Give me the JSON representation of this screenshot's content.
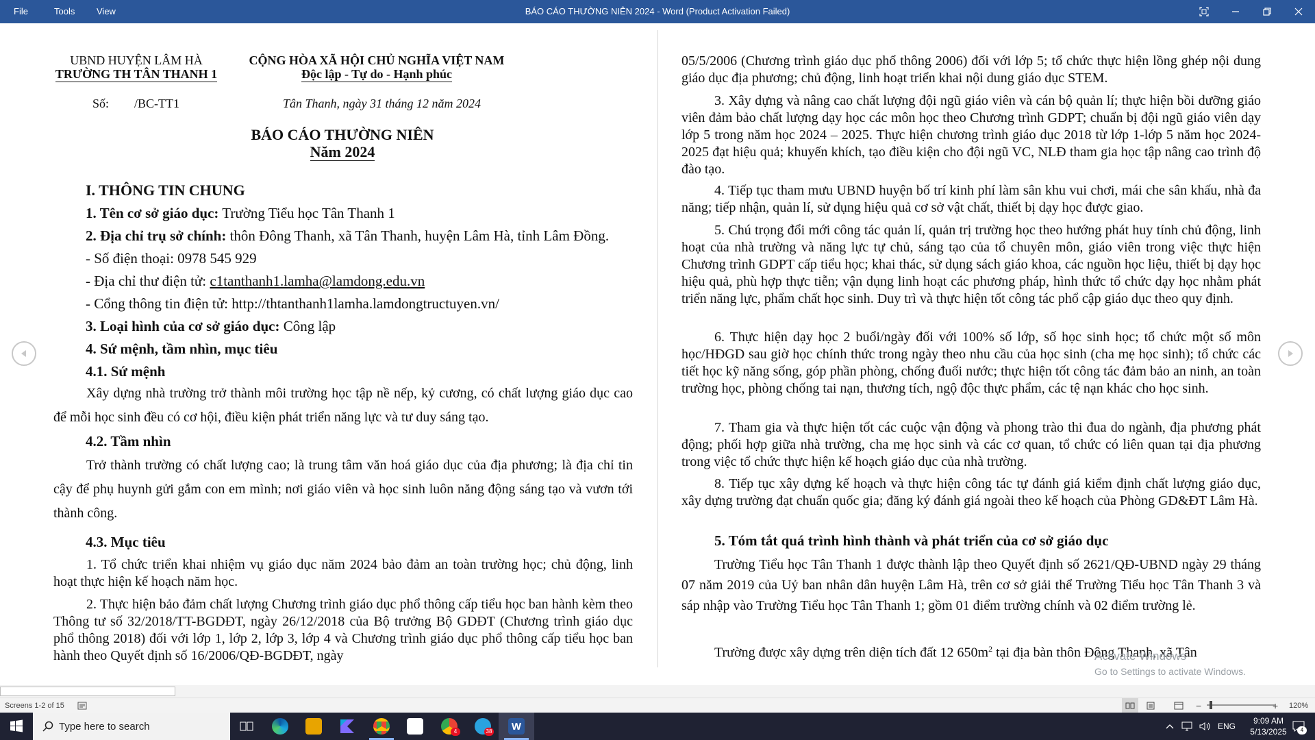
{
  "window": {
    "menu": [
      "File",
      "Tools",
      "View"
    ],
    "title": "BÁO CÁO THƯỜNG NIÊN 2024 - Word (Product Activation Failed)"
  },
  "left_page": {
    "org_line1": "UBND HUYỆN LÂM HÀ",
    "org_line2": "TRƯỜNG TH TÂN THANH 1",
    "nation_line1": "CỘNG HÒA XÃ HỘI CHỦ NGHĨA VIỆT NAM",
    "nation_line2": "Độc lập - Tự do - Hạnh phúc",
    "doc_no_label": "Số:",
    "doc_no_value": "/BC-TT1",
    "place_date": "Tân Thanh, ngày 31 tháng 12 năm 2024",
    "title1": "BÁO CÁO THƯỜNG NIÊN",
    "title2": "Năm 2024",
    "sec1": "I. THÔNG TIN CHUNG",
    "item1_label": "1. Tên cơ sở giáo dục:",
    "item1_value": " Trường Tiểu học Tân Thanh 1",
    "item2_label": "2. Địa chỉ trụ sở chính:",
    "item2_value": " thôn Đông Thanh, xã Tân Thanh, huyện Lâm Hà, tỉnh Lâm Đồng.",
    "phone": "- Số điện thoại: 0978 545 929",
    "email_label": "- Địa chỉ thư điện tử: ",
    "email_value": "c1tanthanh1.lamha@lamdong.edu.vn",
    "portal": "- Cổng thông tin điện tử: http://thtanthanh1lamha.lamdongtructuyen.vn/",
    "item3_label": "3. Loại hình của cơ sở giáo dục:",
    "item3_value": " Công lập",
    "item4": "4. Sứ mệnh, tầm nhìn, mục tiêu",
    "h41": "4.1. Sứ mệnh",
    "p41": "Xây dựng nhà trường trở thành môi trường học tập nề nếp, kỷ cương, có chất lượng giáo dục cao để mỗi học sinh đều có cơ hội, điều kiện phát triển năng lực và tư duy sáng tạo.",
    "h42": "4.2. Tầm nhìn",
    "p42": "Trở thành trường có chất lượng cao; là trung tâm văn hoá giáo dục của địa phương; là địa chỉ tin cậy để phụ huynh gửi gắm con em mình; nơi giáo viên và học sinh luôn năng động sáng tạo và vươn tới thành công.",
    "h43": "4.3. Mục tiêu",
    "p431": "1. Tổ chức triển khai nhiệm vụ giáo dục năm 2024 bảo đảm an toàn trường học; chủ động, linh hoạt thực hiện kế hoạch năm học.",
    "p432": "2. Thực hiện bảo đảm chất lượng Chương trình giáo dục phổ thông cấp tiểu học ban hành kèm theo Thông tư số 32/2018/TT-BGDĐT, ngày 26/12/2018 của Bộ trưởng Bộ GDĐT (Chương trình giáo dục phổ thông 2018) đối với lớp 1, lớp 2, lớp 3, lớp 4 và Chương trình giáo dục phổ thông cấp tiểu học ban hành theo Quyết định số 16/2006/QĐ-BGDĐT, ngày"
  },
  "right_page": {
    "p_cont": "05/5/2006 (Chương trình giáo dục phổ thông 2006) đối với lớp 5; tổ chức thực hiện lồng ghép nội dung giáo dục địa phương; chủ động, linh hoạt triển khai nội dung giáo dục STEM.",
    "p3": "3. Xây dựng và nâng cao chất lượng đội ngũ giáo viên và cán bộ quản lí; thực hiện bồi dưỡng giáo viên đảm bảo chất lượng dạy học các môn học theo Chương trình GDPT; chuẩn bị đội ngũ giáo viên dạy lớp 5 trong năm học 2024 – 2025. Thực hiện chương trình giáo dục 2018 từ lớp 1-lớp 5 năm học 2024-2025 đạt hiệu quả;  khuyến khích, tạo điều kiện cho đội ngũ VC, NLĐ tham gia học tập nâng cao trình độ đào tạo.",
    "p4": "4. Tiếp tục tham mưu UBND huyện bố trí kinh phí làm sân khu vui chơi, mái che sân khấu, nhà đa năng; tiếp nhận, quản lí, sử dụng hiệu quả cơ sở vật chất, thiết bị dạy học được giao.",
    "p5": "5. Chú trọng đổi mới công tác quản lí, quản trị trường học theo hướng phát huy tính chủ động, linh hoạt của nhà trường và năng lực tự chủ, sáng tạo của tổ chuyên môn, giáo viên trong việc thực hiện Chương trình GDPT cấp tiểu học; khai thác, sử dụng sách giáo khoa, các nguồn học liệu, thiết bị dạy học hiệu quả, phù hợp thực tiễn; vận dụng linh hoạt các phương pháp, hình thức tổ chức dạy học nhằm phát triển năng lực, phẩm chất học sinh. Duy trì và thực hiện tốt công tác phổ cập giáo dục theo quy định.",
    "p6": "6. Thực hiện dạy học 2 buổi/ngày đối với 100% số lớp, số học sinh học; tổ chức một số môn học/HĐGD sau giờ học chính thức trong ngày theo nhu cầu của học sinh (cha mẹ học sinh); tổ chức các tiết học kỹ năng sống, góp phần phòng, chống đuối nước; thực hiện tốt công tác đảm bảo an ninh, an toàn trường học, phòng chống tai nạn, thương tích, ngộ độc thực phẩm, các tệ nạn khác cho học sinh.",
    "p7": "7. Tham gia và thực hiện tốt các cuộc vận động và phong trào thi đua do ngành, địa phương phát động; phối hợp giữa nhà trường, cha mẹ học sinh và các cơ quan, tổ chức có liên quan tại địa phương trong việc tổ chức thực hiện kế hoạch giáo dục của nhà trường.",
    "p8": "8. Tiếp tục xây dựng kế hoạch và thực hiện công tác tự đánh giá kiểm định chất lượng giáo dục, xây dựng trường đạt chuẩn quốc gia; đăng ký đánh giá ngoài theo kế hoạch của Phòng GD&ĐT Lâm Hà.",
    "h5": "5. Tóm tắt quá trình hình thành và phát triển của cơ sở giáo dục",
    "p5a": "Trường Tiểu học Tân Thanh 1 được thành lập theo Quyết định số 2621/QĐ-UBND ngày 29 tháng 07 năm 2019 của Uỷ ban nhân dân huyện Lâm Hà, trên cơ sở giải thể Trường Tiểu học Tân Thanh 3 và sáp nhập vào Trường Tiểu học Tân Thanh 1; gồm 01 điểm trường chính và 02 điểm trường lẻ.",
    "p5b_pre": "Trường được xây dựng trên diện tích đất 12 650m",
    "p5b_sup": "2",
    "p5b_post": " tại địa bàn thôn Đông Thanh, xã Tân"
  },
  "watermark": {
    "line1": "Activate Windows",
    "line2": "Go to Settings to activate Windows."
  },
  "statusbar": {
    "screens": "Screens 1-2 of 15",
    "zoom": "120%"
  },
  "taskbar": {
    "search_placeholder": "Type here to search",
    "lang": "ENG",
    "time": "9:09 AM",
    "date": "5/13/2025",
    "notif_count": "4",
    "badge_chrome": "4",
    "badge_telegram": "38"
  },
  "colors": {
    "titlebar": "#2b579a",
    "taskbar": "#1f2233",
    "text": "#111111"
  }
}
